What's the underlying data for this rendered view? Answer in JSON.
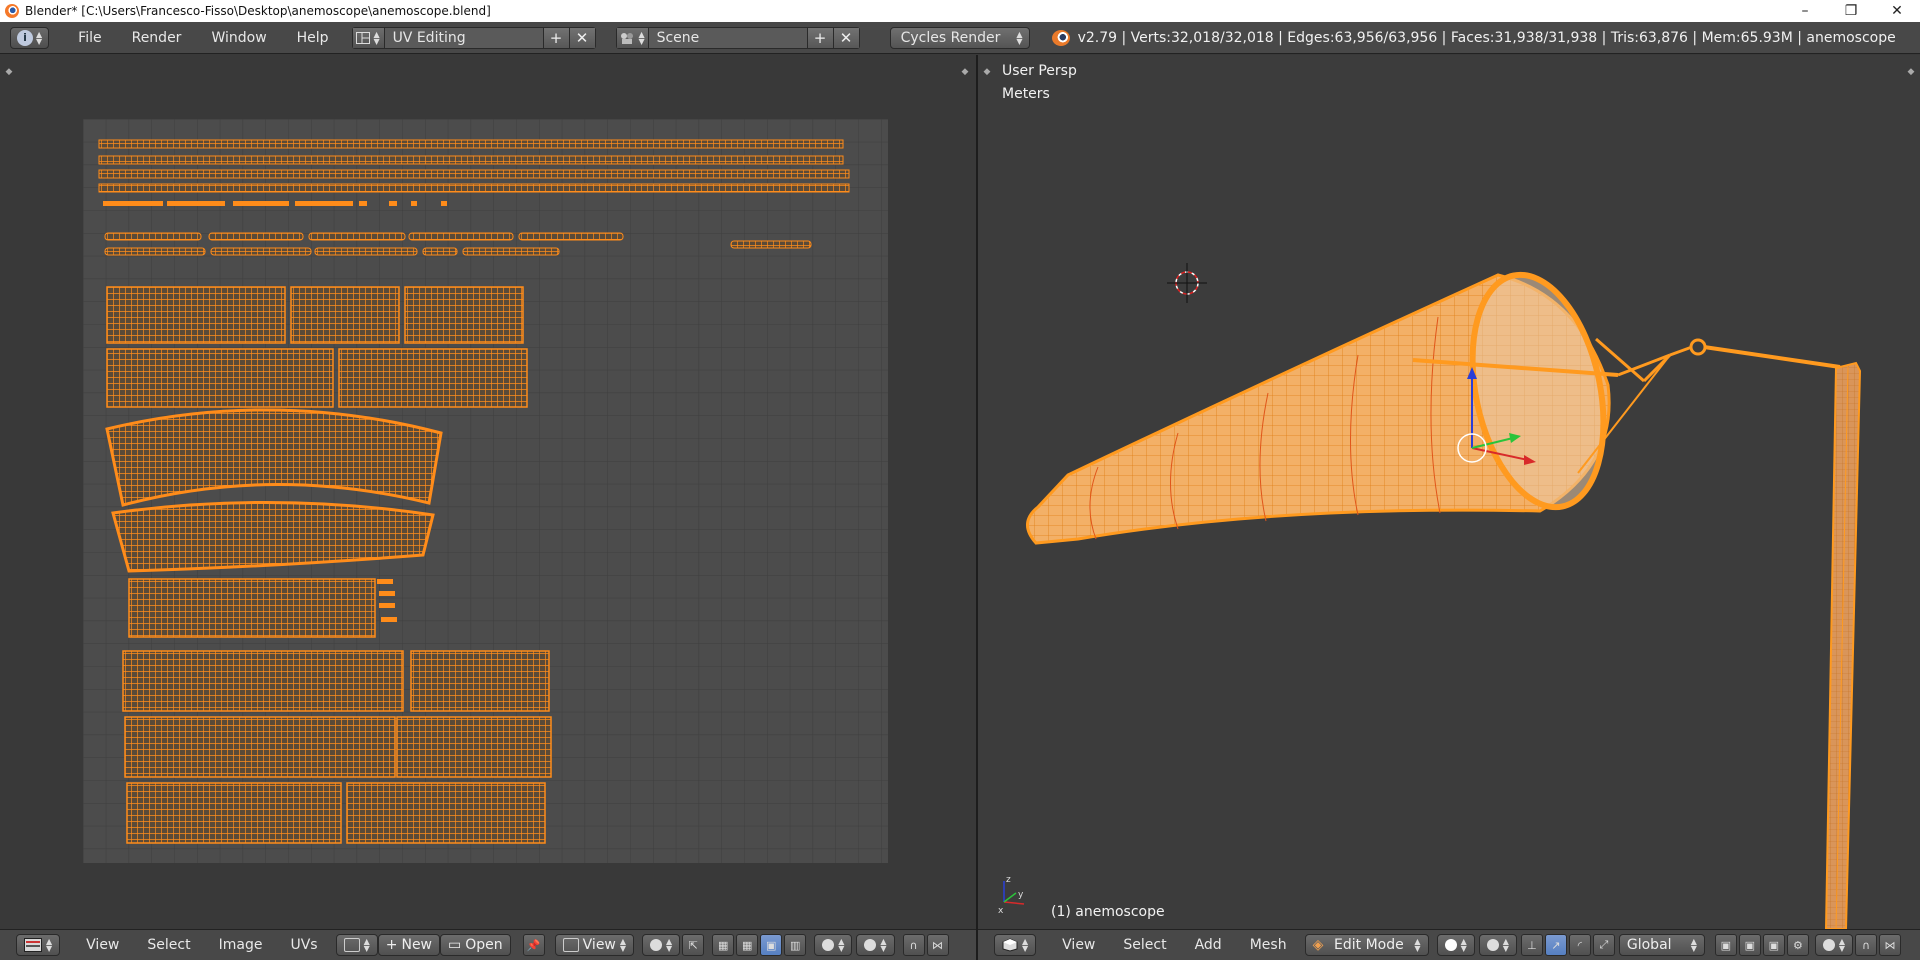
{
  "window": {
    "title": "Blender* [C:\\Users\\Francesco-Fisso\\Desktop\\anemoscope\\anemoscope.blend]",
    "minimize": "–",
    "maximize": "❐",
    "close": "✕"
  },
  "info_header": {
    "menus": [
      "File",
      "Render",
      "Window",
      "Help"
    ],
    "screen_layout": "UV Editing",
    "scene": "Scene",
    "render_engine": "Cycles Render",
    "stats": "v2.79 | Verts:32,018/32,018 | Edges:63,956/63,956 | Faces:31,938/31,938 | Tris:63,876 | Mem:65.93M | anemoscope",
    "add_symbol": "+",
    "remove_symbol": "✕"
  },
  "uv_editor": {
    "menus": [
      "View",
      "Select",
      "Image",
      "UVs"
    ],
    "new_label": "New",
    "open_label": "Open",
    "view_label": "View"
  },
  "viewport": {
    "view_name": "User Persp",
    "units": "Meters",
    "object_label": "(1) anemoscope",
    "menus": [
      "View",
      "Select",
      "Add",
      "Mesh"
    ],
    "mode": "Edit Mode",
    "orientation": "Global"
  },
  "colors": {
    "uv_orange": "#ff8c1a",
    "background": "#393939",
    "header": "#484848",
    "active_blue": "#5680c2"
  }
}
